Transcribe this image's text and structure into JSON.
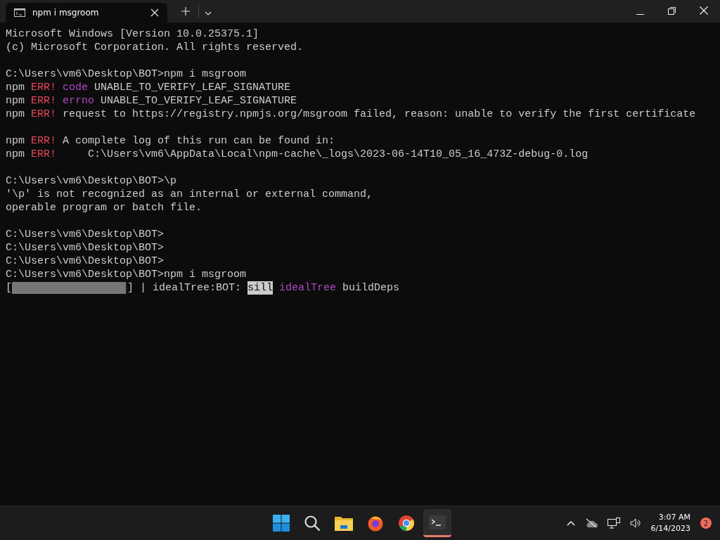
{
  "window": {
    "tab_title": "npm i msgroom"
  },
  "terminal": {
    "paragraphs": [
      [
        [
          {
            "kind": "plain",
            "text": "Microsoft Windows [Version 10.0.25375.1]"
          }
        ],
        [
          {
            "kind": "plain",
            "text": "(c) Microsoft Corporation. All rights reserved."
          }
        ]
      ],
      [
        [
          {
            "kind": "plain",
            "text": "C:\\Users\\vm6\\Desktop\\BOT>npm i msgroom"
          }
        ],
        [
          {
            "kind": "plain",
            "text": "npm "
          },
          {
            "kind": "error",
            "text": "ERR!"
          },
          {
            "kind": "space"
          },
          {
            "kind": "keyword",
            "text": "code"
          },
          {
            "kind": "plain",
            "text": " UNABLE_TO_VERIFY_LEAF_SIGNATURE"
          }
        ],
        [
          {
            "kind": "plain",
            "text": "npm "
          },
          {
            "kind": "error",
            "text": "ERR!"
          },
          {
            "kind": "space"
          },
          {
            "kind": "keyword",
            "text": "errno"
          },
          {
            "kind": "plain",
            "text": " UNABLE_TO_VERIFY_LEAF_SIGNATURE"
          }
        ],
        [
          {
            "kind": "plain",
            "text": "npm "
          },
          {
            "kind": "error",
            "text": "ERR!"
          },
          {
            "kind": "plain",
            "text": " request to https://registry.npmjs.org/msgroom failed, reason: unable to verify the first certificate"
          }
        ]
      ],
      [
        [
          {
            "kind": "plain",
            "text": "npm "
          },
          {
            "kind": "error",
            "text": "ERR!"
          },
          {
            "kind": "plain",
            "text": " A complete log of this run can be found in:"
          }
        ],
        [
          {
            "kind": "plain",
            "text": "npm "
          },
          {
            "kind": "error",
            "text": "ERR!"
          },
          {
            "kind": "plain",
            "text": "     C:\\Users\\vm6\\AppData\\Local\\npm-cache\\_logs\\2023-06-14T10_05_16_473Z-debug-0.log"
          }
        ]
      ],
      [
        [
          {
            "kind": "plain",
            "text": "C:\\Users\\vm6\\Desktop\\BOT>\\p"
          }
        ],
        [
          {
            "kind": "plain",
            "text": "'\\p' is not recognized as an internal or external command,"
          }
        ],
        [
          {
            "kind": "plain",
            "text": "operable program or batch file."
          }
        ]
      ],
      [
        [
          {
            "kind": "plain",
            "text": "C:\\Users\\vm6\\Desktop\\BOT>"
          }
        ],
        [
          {
            "kind": "plain",
            "text": "C:\\Users\\vm6\\Desktop\\BOT>"
          }
        ],
        [
          {
            "kind": "plain",
            "text": "C:\\Users\\vm6\\Desktop\\BOT>"
          }
        ],
        [
          {
            "kind": "plain",
            "text": "C:\\Users\\vm6\\Desktop\\BOT>npm i msgroom"
          }
        ],
        [
          {
            "kind": "plain",
            "text": "["
          },
          {
            "kind": "gauge",
            "level": 0.99
          },
          {
            "kind": "plain",
            "text": "] | idealTree:BOT: "
          },
          {
            "kind": "inverse",
            "text": "sill"
          },
          {
            "kind": "space"
          },
          {
            "kind": "keyword",
            "text": "idealTree"
          },
          {
            "kind": "plain",
            "text": " buildDeps"
          }
        ]
      ]
    ]
  },
  "taskbar": {
    "clock_time": "3:07 AM",
    "clock_date": "6/14/2023",
    "notification_count": "2"
  }
}
